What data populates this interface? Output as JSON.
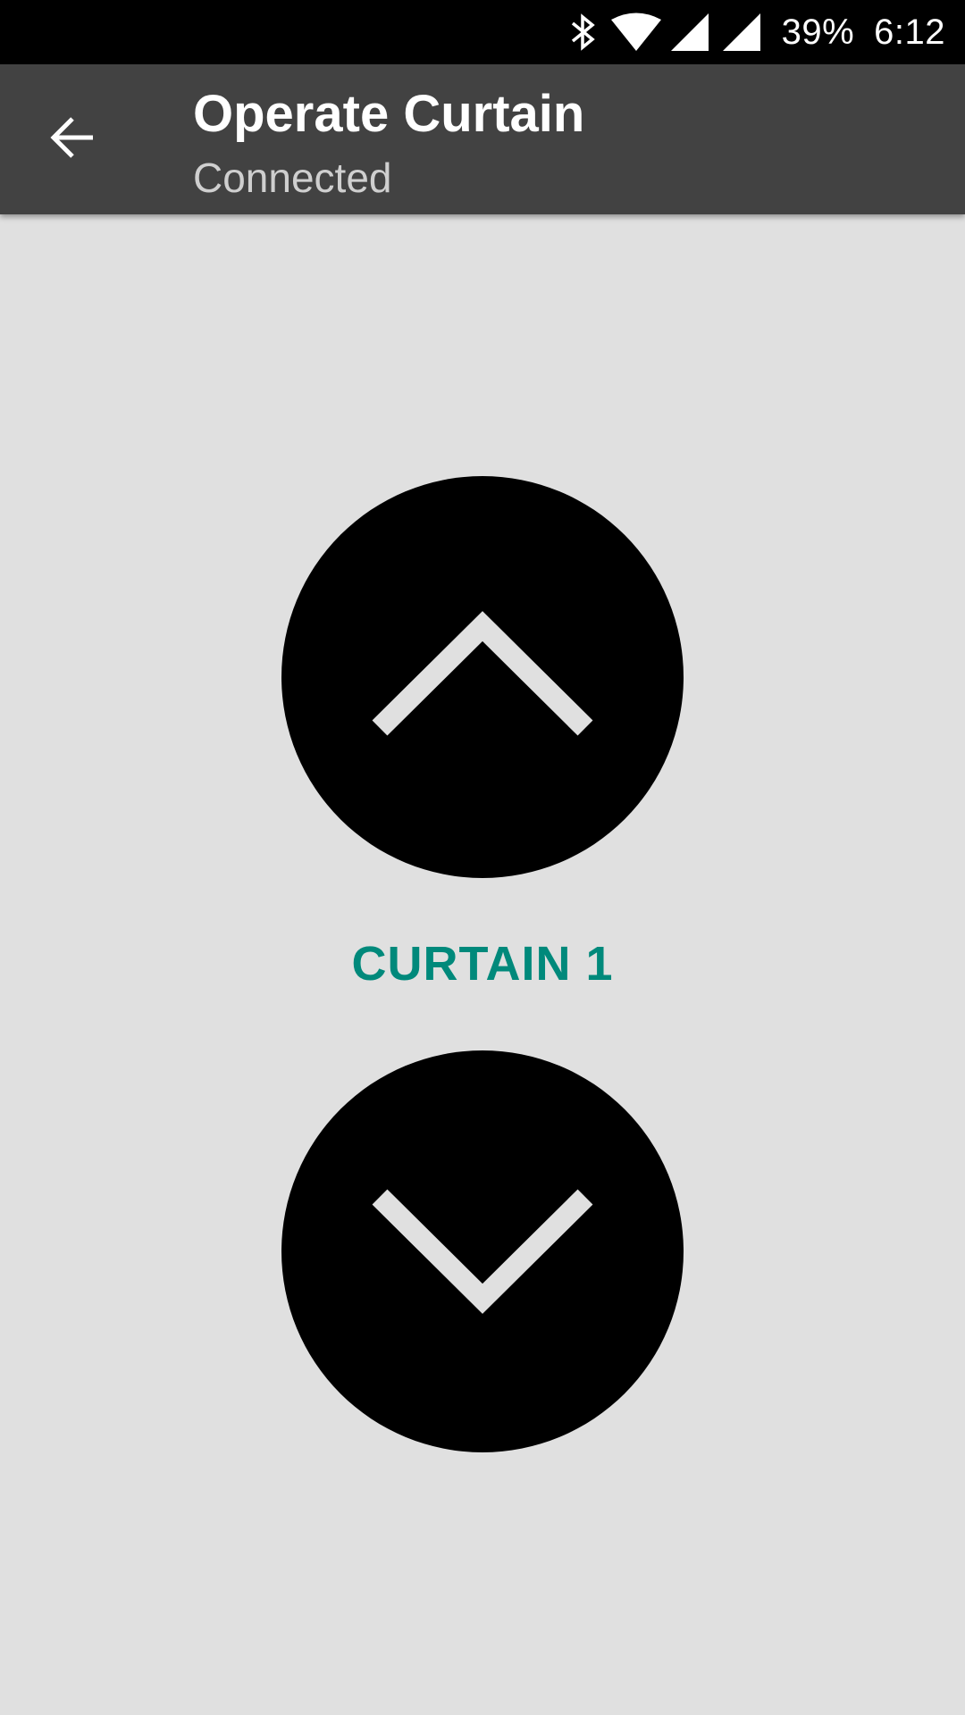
{
  "status_bar": {
    "icons": [
      "bluetooth-icon",
      "wifi-icon",
      "signal-icon",
      "signal-icon"
    ],
    "battery": "39%",
    "time": "6:12"
  },
  "app_bar": {
    "back_icon": "arrow-back-icon",
    "title": "Operate Curtain",
    "subtitle": "Connected"
  },
  "controls": {
    "up_icon": "chevron-up-icon",
    "label": "CURTAIN 1",
    "down_icon": "chevron-down-icon"
  },
  "colors": {
    "status_bar": "#000000",
    "app_bar": "#424242",
    "background": "#e0e0e0",
    "button": "#000000",
    "chevron": "#e0e0e0",
    "label": "#00897b"
  }
}
